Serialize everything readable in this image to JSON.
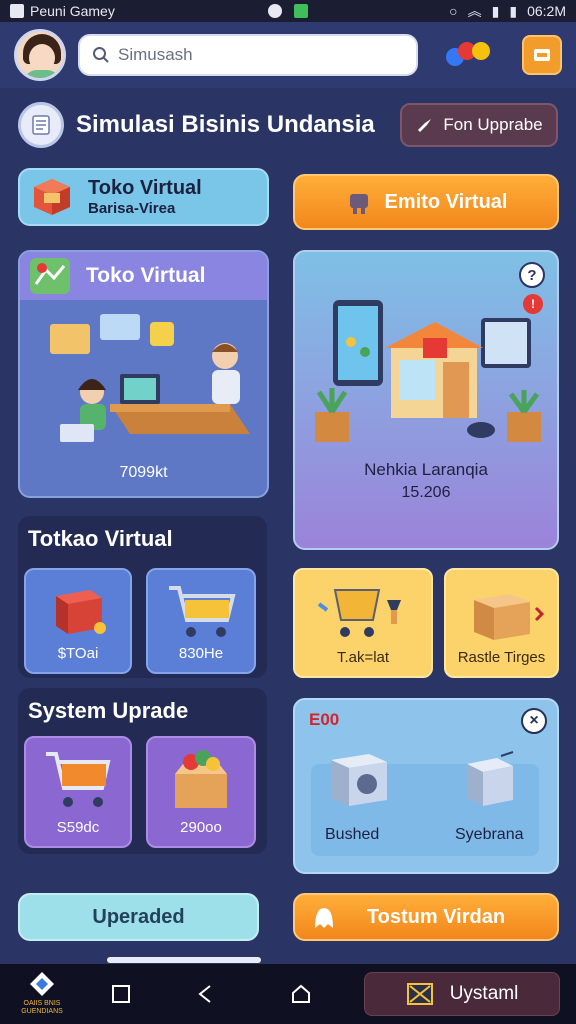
{
  "status": {
    "app": "Peuni Gamey",
    "time": "06:2M"
  },
  "search": {
    "placeholder": "Simusash"
  },
  "header": {
    "title": "Simulasi Bisinis Undansia",
    "upgrade_label": "Fon Upprabe"
  },
  "cards": {
    "toko_small": {
      "title": "Toko Virtual",
      "subtitle": "Barisa-Virea"
    },
    "emito": {
      "label": "Emito Virtual"
    },
    "toko_big": {
      "title": "Toko Virtual",
      "price": "7099kt"
    },
    "nehkia": {
      "caption": "Nehkia Laranqia",
      "value": "15.206"
    }
  },
  "sections": {
    "totkao": {
      "title": "Totkao Virtual",
      "tiles": [
        {
          "label": "$TOai"
        },
        {
          "label": "830He"
        }
      ]
    },
    "yellow_tiles": [
      {
        "label": "T.ak=lat"
      },
      {
        "label": "Rastle Tirges"
      }
    ],
    "system_upgrade": {
      "title": "System Uprade",
      "tiles": [
        {
          "label": "S59dc"
        },
        {
          "label": "290oo"
        }
      ]
    },
    "bushed": {
      "number": "E00",
      "items": [
        {
          "label": "Bushed"
        },
        {
          "label": "Syebrana"
        }
      ]
    }
  },
  "buttons": {
    "uperaded": "Uperaded",
    "tostum": "Tostum Virdan"
  },
  "navbar": {
    "logo_text": "OAIIS BNIS GUENDIANS",
    "system_label": "Uystaml"
  },
  "colors": {
    "accent_orange": "#f29c2b",
    "bg": "#2a3566",
    "header": "#2e3a70"
  }
}
